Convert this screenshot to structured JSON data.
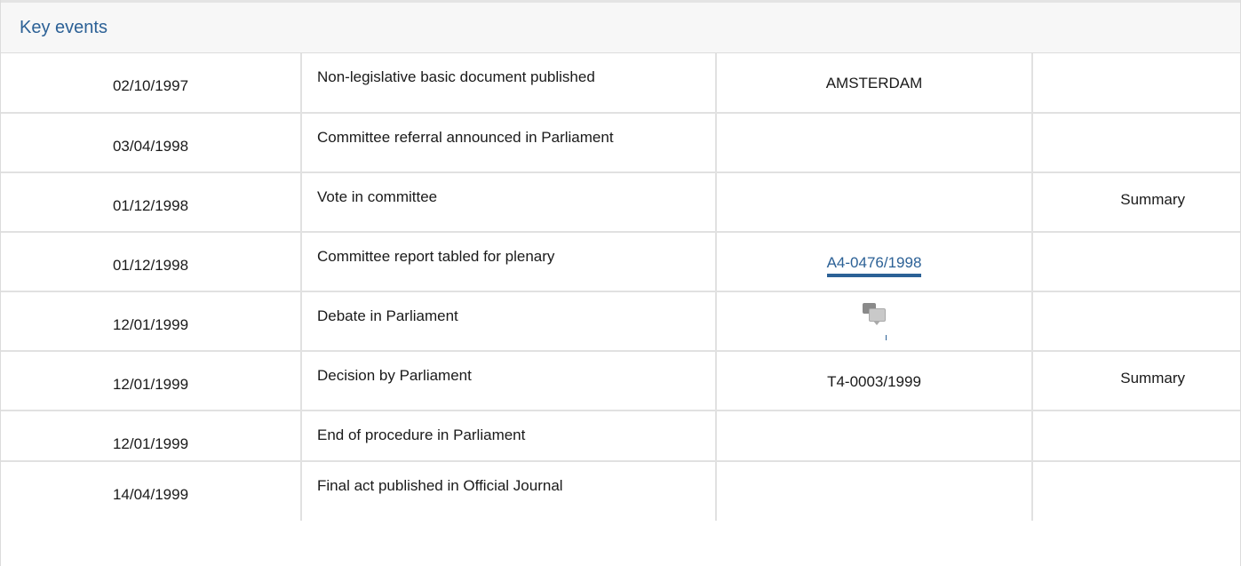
{
  "panel": {
    "title": "Key events"
  },
  "events": [
    {
      "date": "02/10/1997",
      "event": "Non-legislative basic document published",
      "ref": "AMSTERDAM",
      "summary": ""
    },
    {
      "date": "03/04/1998",
      "event": "Committee referral announced in Parliament",
      "ref": "",
      "summary": ""
    },
    {
      "date": "01/12/1998",
      "event": "Vote in committee",
      "ref": "",
      "summary": "Summary"
    },
    {
      "date": "01/12/1998",
      "event": "Committee report tabled for plenary",
      "ref": "A4-0476/1998",
      "summary": ""
    },
    {
      "date": "12/01/1999",
      "event": "Debate in Parliament",
      "ref": "",
      "summary": ""
    },
    {
      "date": "12/01/1999",
      "event": "Decision by Parliament",
      "ref": "T4-0003/1999",
      "summary": "Summary"
    },
    {
      "date": "12/01/1999",
      "event": "End of procedure in Parliament",
      "ref": "",
      "summary": ""
    },
    {
      "date": "14/04/1999",
      "event": "Final act published in Official Journal",
      "ref": "",
      "summary": ""
    }
  ],
  "icons": {
    "debate": "debate-speech-bubbles-icon"
  },
  "colors": {
    "link": "#2c6196",
    "header_bg": "#f7f7f7",
    "border": "#e1e1e1"
  }
}
